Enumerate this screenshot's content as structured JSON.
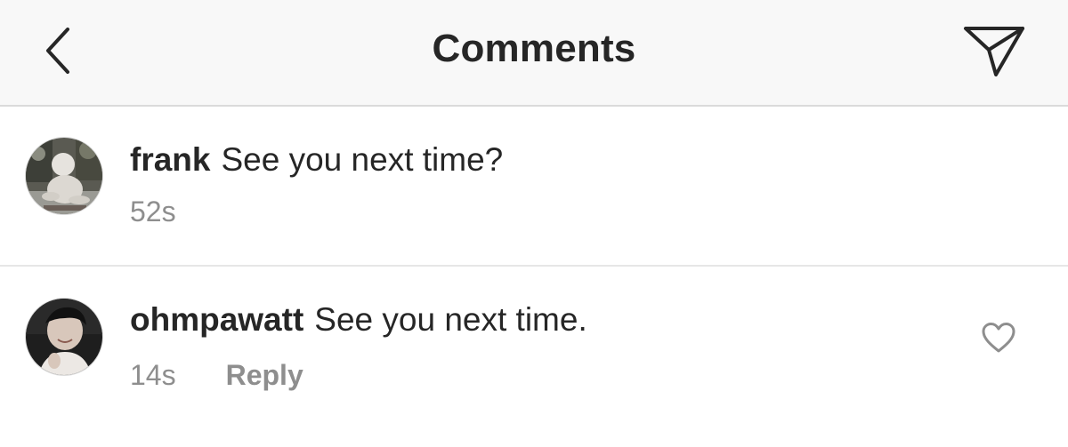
{
  "header": {
    "title": "Comments",
    "back_icon": "chevron-left-icon",
    "send_icon": "paper-plane-icon"
  },
  "comments": [
    {
      "username": "frank",
      "text": "See you next time?",
      "time": "52s",
      "avatar": "baby-photo-avatar"
    },
    {
      "username": "ohmpawatt",
      "text": "See you next time.",
      "time": "14s",
      "reply_label": "Reply",
      "avatar": "person-photo-avatar",
      "like_icon": "heart-outline-icon"
    }
  ],
  "colors": {
    "header_bg": "#f8f8f8",
    "text": "#262626",
    "meta": "#8e8e8e",
    "divider": "#dbdbdb"
  }
}
